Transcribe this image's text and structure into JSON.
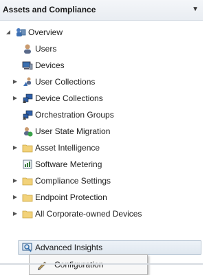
{
  "pane": {
    "title": "Assets and Compliance"
  },
  "tree": {
    "root_label": "Overview",
    "items": [
      {
        "label": "Users",
        "icon": "users-icon"
      },
      {
        "label": "Devices",
        "icon": "devices-icon"
      },
      {
        "label": "User Collections",
        "icon": "user-collections-icon"
      },
      {
        "label": "Device Collections",
        "icon": "device-collections-icon"
      },
      {
        "label": "Orchestration Groups",
        "icon": "orchestration-groups-icon"
      },
      {
        "label": "User State Migration",
        "icon": "user-state-migration-icon"
      },
      {
        "label": "Asset Intelligence",
        "icon": "folder-icon"
      },
      {
        "label": "Software Metering",
        "icon": "software-metering-icon"
      },
      {
        "label": "Compliance Settings",
        "icon": "folder-icon"
      },
      {
        "label": "Endpoint Protection",
        "icon": "folder-icon"
      },
      {
        "label": "All Corporate-owned Devices",
        "icon": "folder-icon"
      },
      {
        "label": "Advanced Insights",
        "icon": "advanced-insights-icon"
      }
    ]
  },
  "context_menu": {
    "item_label": "Configuration"
  }
}
